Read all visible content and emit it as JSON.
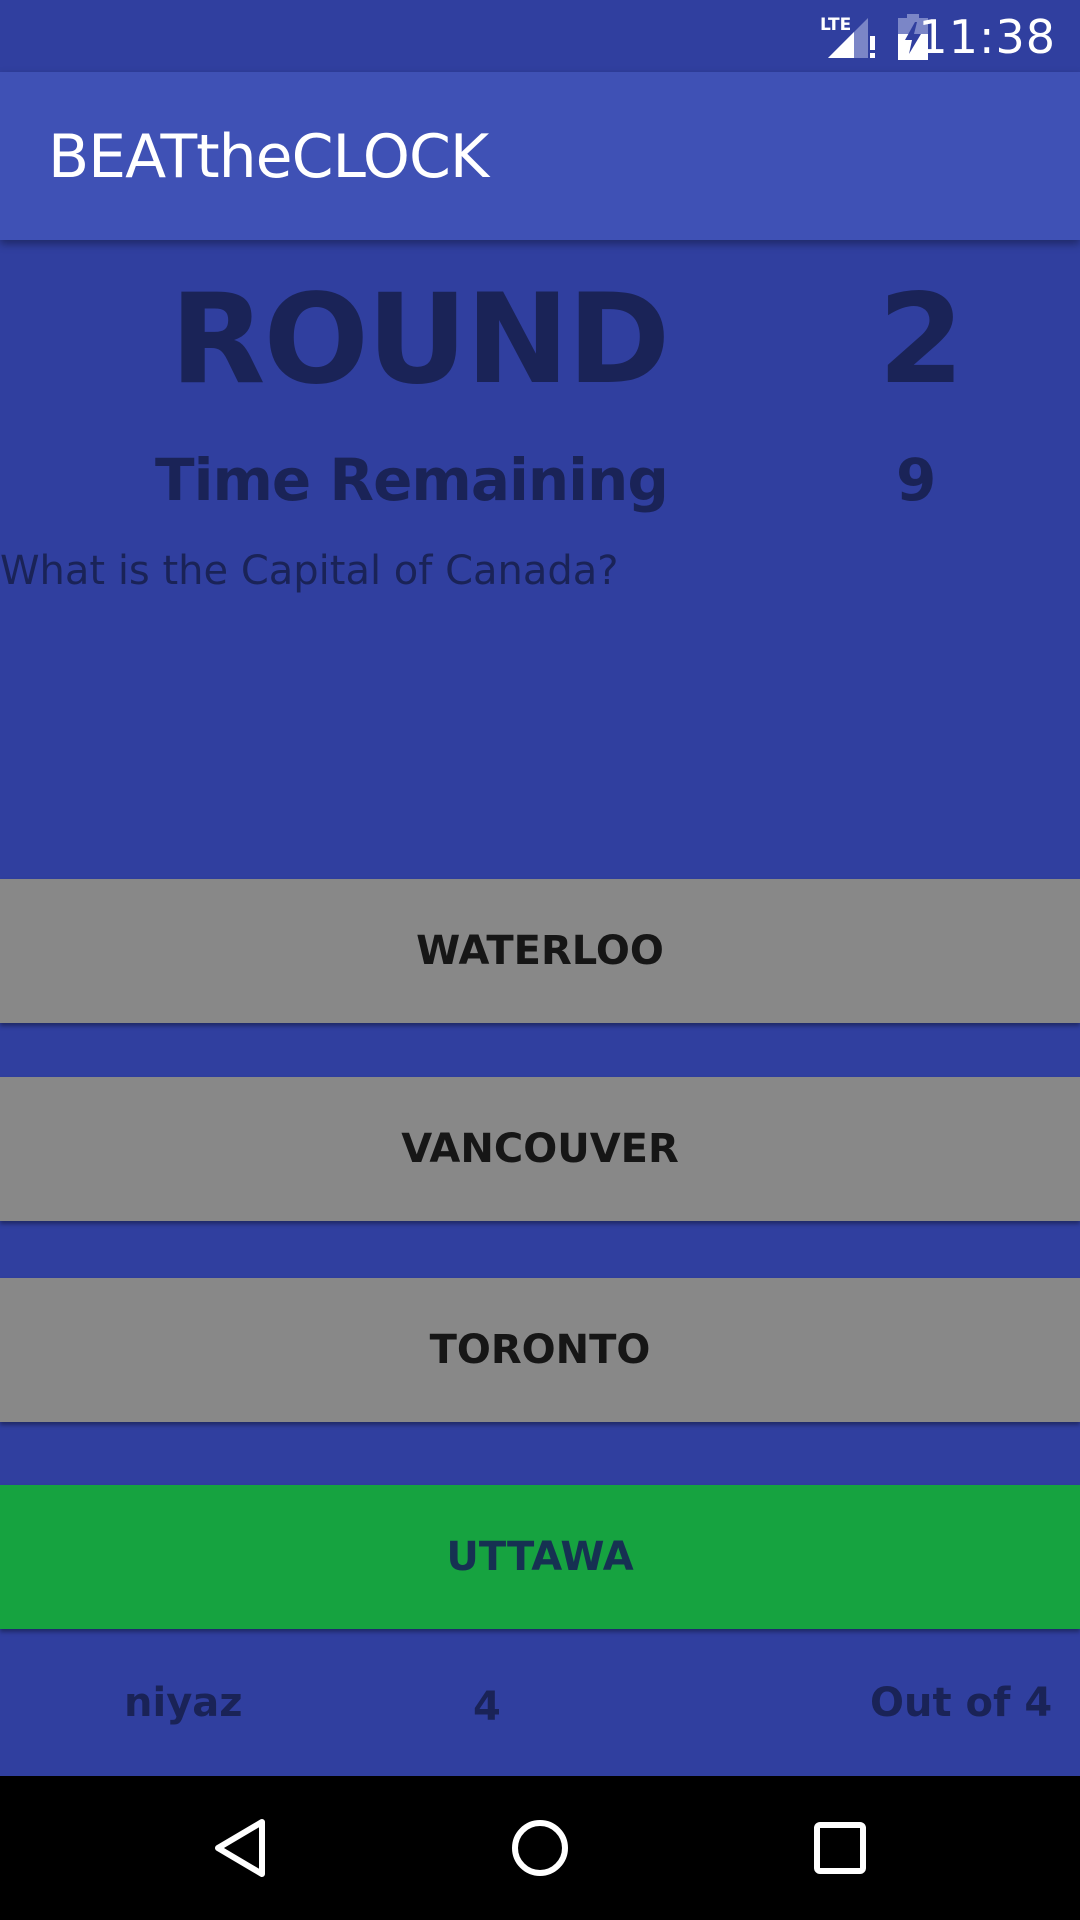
{
  "status_bar": {
    "time": "11:38",
    "network": "LTE",
    "signal_icon": "signal-icon",
    "battery_icon": "battery-charging-icon"
  },
  "app_bar": {
    "title": "BEATtheCLOCK"
  },
  "game": {
    "round_label": "ROUND",
    "round_value": "2",
    "time_label": "Time Remaining",
    "time_value": "9",
    "question": "What is the Capital of Canada?"
  },
  "answers": [
    {
      "label": "WATERLOO",
      "state": "default"
    },
    {
      "label": "VANCOUVER",
      "state": "default"
    },
    {
      "label": "TORONTO",
      "state": "default"
    },
    {
      "label": "UTTAWA",
      "state": "correct"
    }
  ],
  "footer": {
    "player_name": "niyaz",
    "score": "4",
    "out_of": "Out of 4"
  },
  "nav_bar": {
    "back_icon": "back-icon",
    "home_icon": "home-icon",
    "recents_icon": "recents-icon"
  },
  "colors": {
    "background": "#303f9f",
    "app_bar": "#3f51b5",
    "text_dark": "#1a2357",
    "answer_default": "#888888",
    "answer_correct": "#16a340"
  }
}
